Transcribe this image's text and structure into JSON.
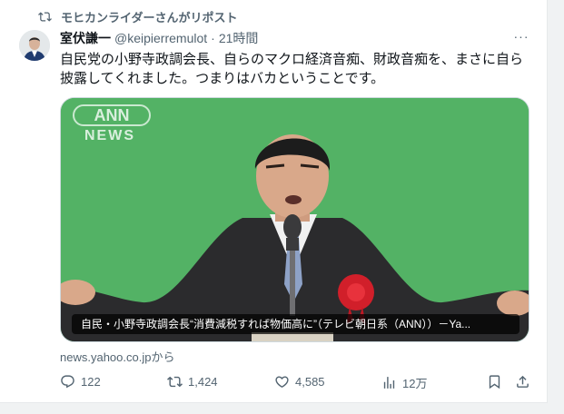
{
  "repost": {
    "label": "モヒカンライダーさんがリポスト",
    "icon": "repost-icon"
  },
  "tweet": {
    "author_name": "室伏謙一",
    "handle": "@keipierremulot",
    "separator": "·",
    "time": "21時間",
    "more_label": "···",
    "text_line1": "自民党の小野寺政調会長、自らのマクロ経済音痴、財政音痴を、まさに自ら",
    "text_line2": "披露してくれました。つまりはバカということです。"
  },
  "media": {
    "logo_top": "ANN",
    "logo_bottom": "NEWS",
    "caption": "自民・小野寺政調会長“消費減税すれば物価高に”（テレビ朝日系（ANN））－Ya...",
    "background_color": "#4fae61"
  },
  "link_source": "news.yahoo.co.jpから",
  "actions": {
    "replies": "122",
    "reposts": "1,424",
    "likes": "4,585",
    "views": "12万"
  }
}
